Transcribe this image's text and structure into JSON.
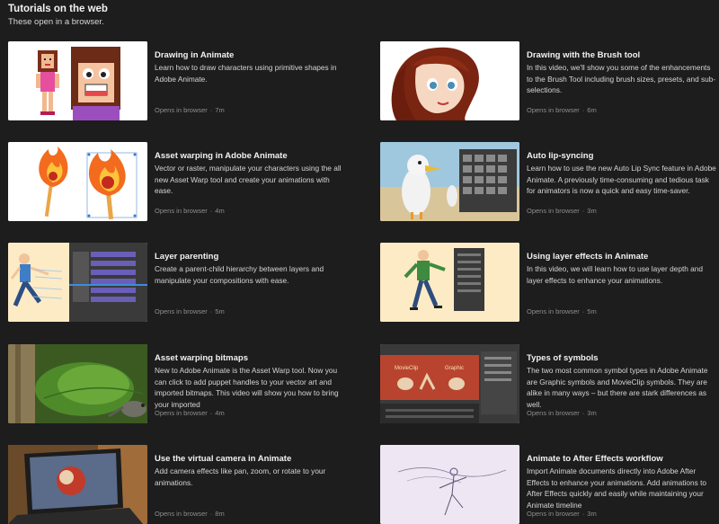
{
  "section": {
    "title": "Tutorials on the web",
    "subtitle": "These open in a browser."
  },
  "meta": {
    "opens_label": "Opens in browser",
    "separator": "·"
  },
  "cards": [
    {
      "title": "Drawing in Animate",
      "desc": "Learn how to draw characters using primitive shapes in Adobe Animate.",
      "duration": "7m",
      "icon": "cartoon-characters"
    },
    {
      "title": "Drawing with the Brush tool",
      "desc": "In this video, we'll show you some of the enhancements to the Brush Tool including brush sizes, presets, and sub-selections.",
      "duration": "6m",
      "icon": "red-haired-girl"
    },
    {
      "title": "Asset warping in Adobe Animate",
      "desc": "Vector or raster, manipulate your characters using the all new Asset Warp tool and create your animations with ease.",
      "duration": "4m",
      "icon": "fire-matches"
    },
    {
      "title": "Auto lip-syncing",
      "desc": "Learn how to use the new Auto Lip Sync feature in Adobe Animate. A previously time-consuming and tedious task for animators is now a quick and easy time-saver.",
      "duration": "3m",
      "icon": "seagull-scene"
    },
    {
      "title": "Layer parenting",
      "desc": "Create a parent-child hierarchy between layers and manipulate your compositions with ease.",
      "duration": "5m",
      "icon": "running-figure-timeline"
    },
    {
      "title": "Using layer effects in Animate",
      "desc": "In this video, we will learn how to use layer depth and layer effects to enhance your animations.",
      "duration": "5m",
      "icon": "walking-man"
    },
    {
      "title": "Asset warping bitmaps",
      "desc": "New to Adobe Animate is the Asset Warp tool. Now you can click to add puppet handles to your vector art and imported bitmaps. This video will show you how to bring your imported",
      "duration": "4m",
      "icon": "lizard-leaf"
    },
    {
      "title": "Types of symbols",
      "desc": "The two most common symbol types in Adobe Animate are Graphic symbols and MovieClip symbols. They are alike in many ways – but there are stark differences as well.",
      "duration": "3m",
      "icon": "movieclip-graphic"
    },
    {
      "title": "Use the virtual camera in Animate",
      "desc": "Add camera effects like pan, zoom, or rotate to your animations.",
      "duration": "8m",
      "icon": "laptop-camera"
    },
    {
      "title": "Animate to After Effects workflow",
      "desc": "Import Animate documents directly into Adobe After Effects to enhance your animations. Add animations to After Effects quickly and easily while maintaining your Animate timeline",
      "duration": "3m",
      "icon": "dancer-sketch"
    }
  ],
  "thumb_labels": {
    "movieclip": "MovieClip",
    "graphic": "Graphic"
  }
}
